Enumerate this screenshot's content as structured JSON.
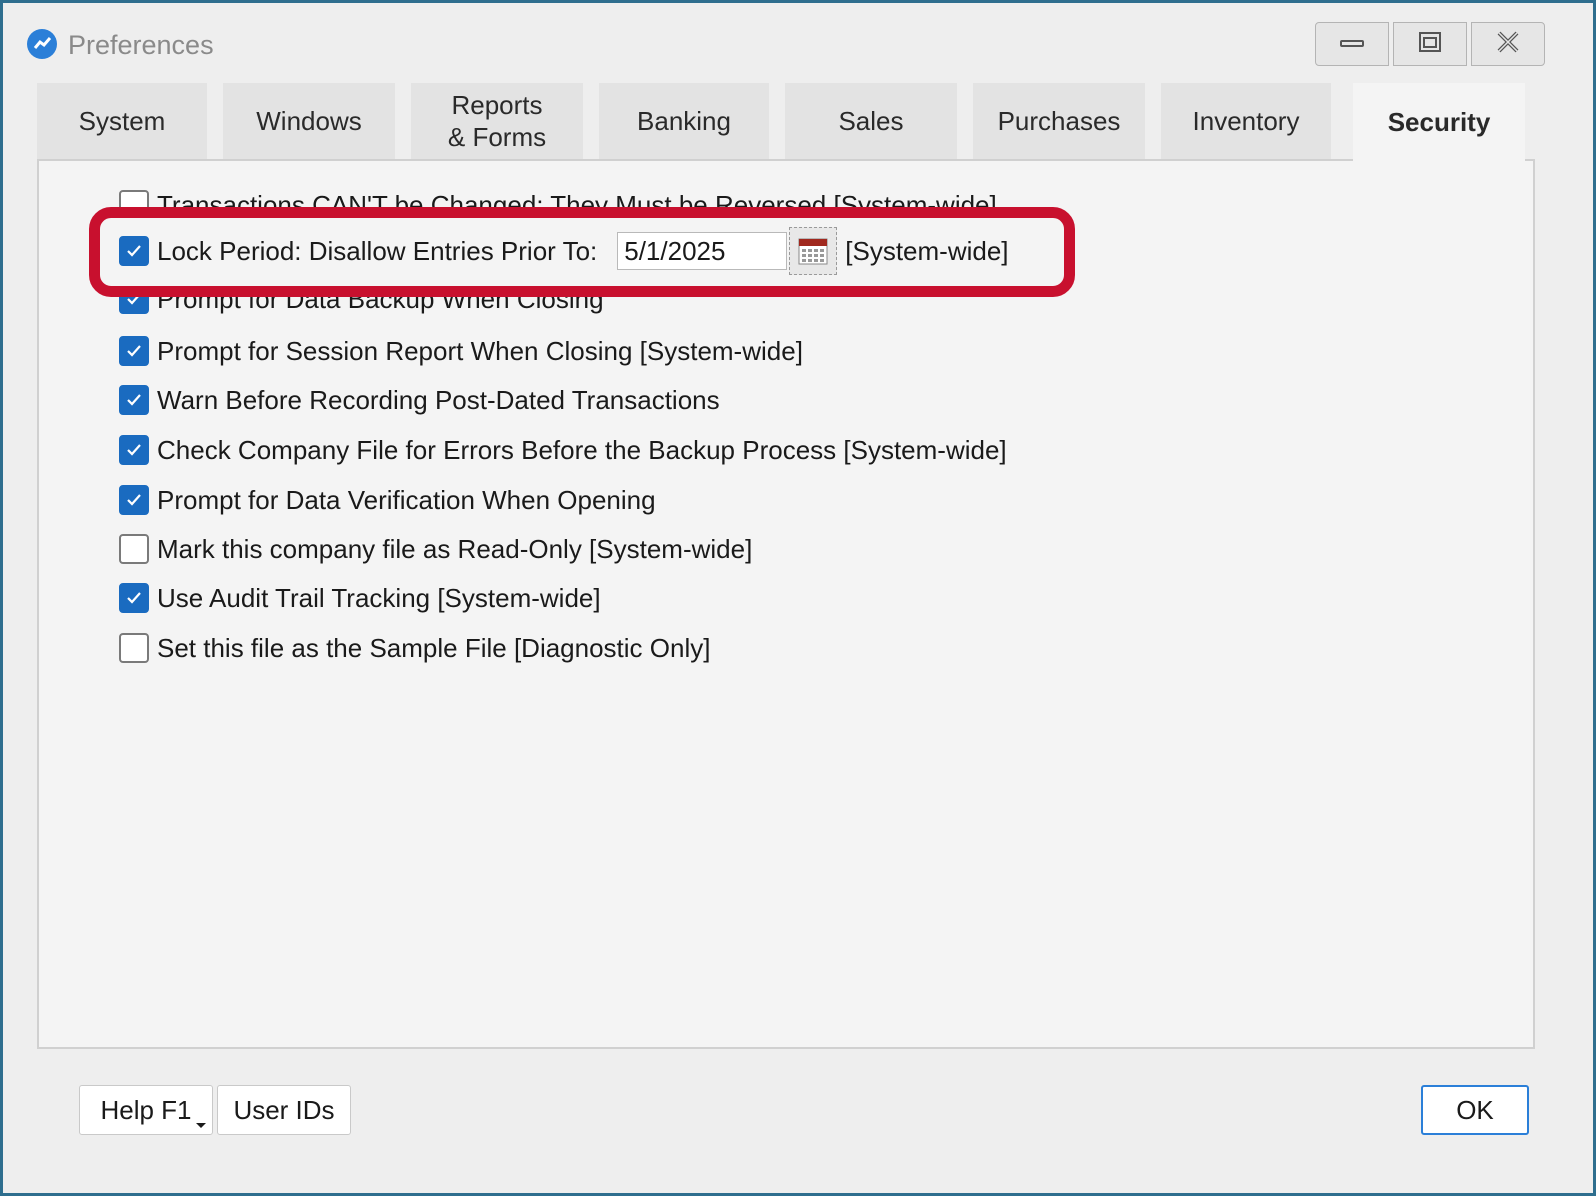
{
  "window": {
    "title": "Preferences"
  },
  "tabs": [
    {
      "label": "System"
    },
    {
      "label": "Windows"
    },
    {
      "label_line1": "Reports",
      "label_line2": "& Forms"
    },
    {
      "label": "Banking"
    },
    {
      "label": "Sales"
    },
    {
      "label": "Purchases"
    },
    {
      "label": "Inventory"
    },
    {
      "label": "Security",
      "active": true
    }
  ],
  "options": [
    {
      "label": "Transactions CAN'T be Changed; They Must be Reversed [System-wide]",
      "checked": false
    },
    {
      "label": "Lock Period: Disallow Entries Prior To:",
      "checked": true,
      "date_value": "5/1/2025",
      "suffix": "[System-wide]"
    },
    {
      "label": "Prompt for Data Backup When Closing",
      "checked": true
    },
    {
      "label": "Prompt for Session Report When Closing [System-wide]",
      "checked": true
    },
    {
      "label": "Warn Before Recording Post-Dated Transactions",
      "checked": true
    },
    {
      "label": "Check Company File for Errors Before the Backup Process [System-wide]",
      "checked": true
    },
    {
      "label": "Prompt for Data Verification When Opening",
      "checked": true
    },
    {
      "label": "Mark this company file as Read-Only [System-wide]",
      "checked": false
    },
    {
      "label": "Use Audit Trail Tracking [System-wide]",
      "checked": true
    },
    {
      "label": "Set this file as the Sample File [Diagnostic Only]",
      "checked": false
    }
  ],
  "footer": {
    "help_label": "Help F1",
    "user_ids_label": "User IDs",
    "ok_label": "OK"
  },
  "colors": {
    "accent": "#1a6bc0",
    "highlight": "#c8102e"
  }
}
